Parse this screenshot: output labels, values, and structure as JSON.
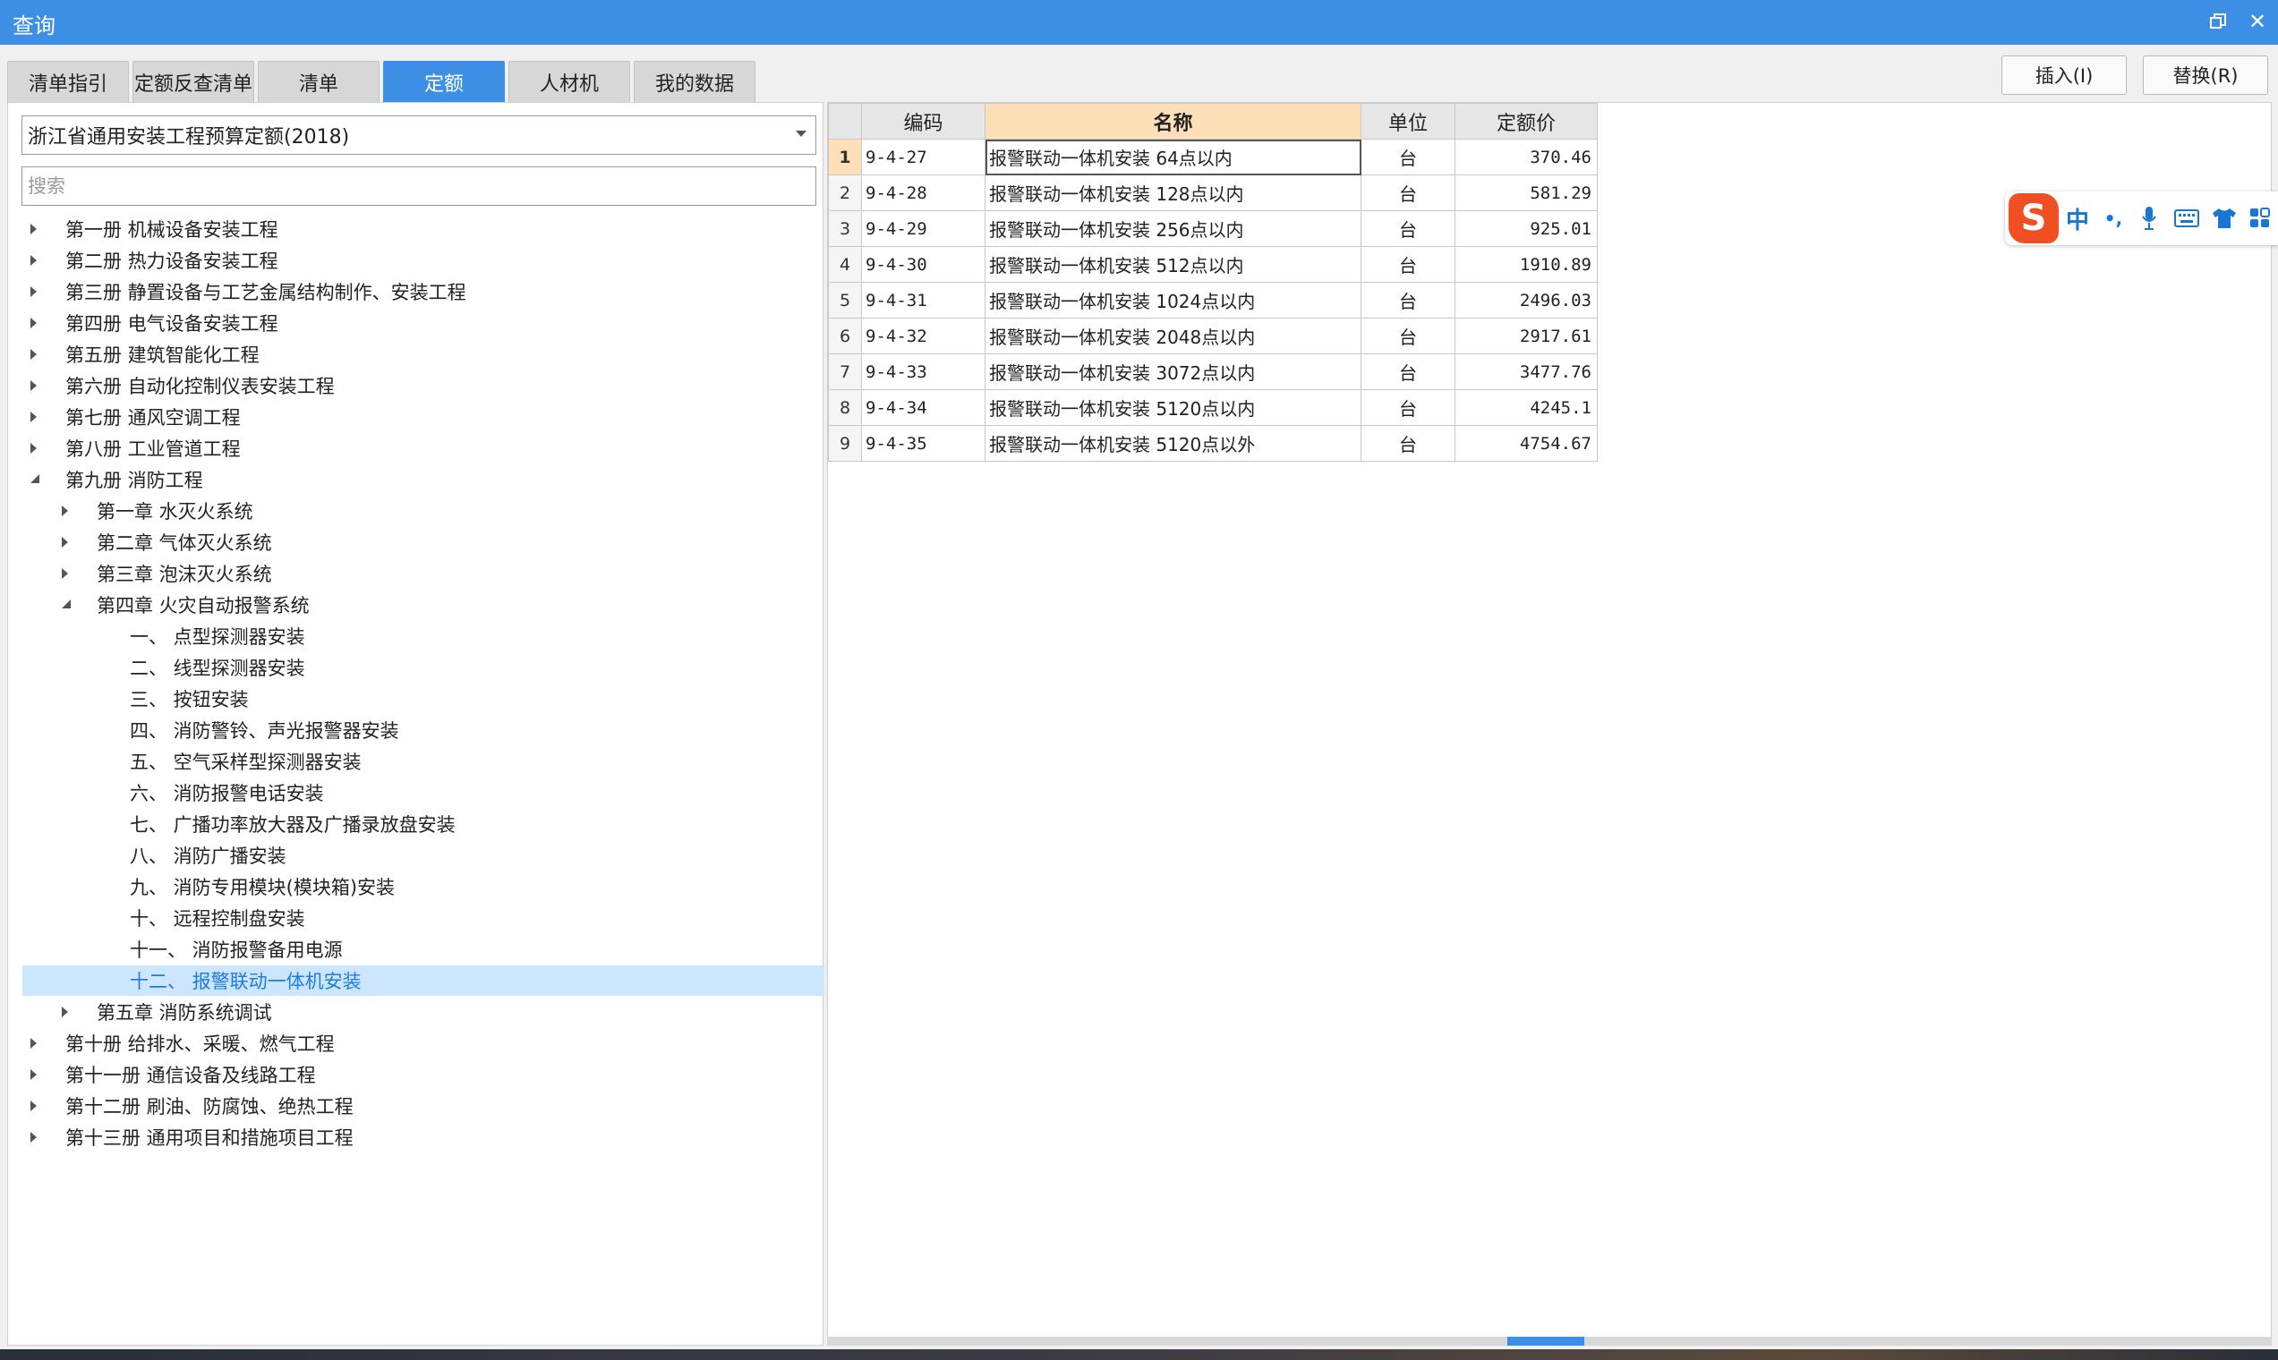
{
  "window": {
    "title": "查询"
  },
  "tabs": [
    {
      "label": "清单指引"
    },
    {
      "label": "定额反查清单"
    },
    {
      "label": "清单"
    },
    {
      "label": "定额"
    },
    {
      "label": "人材机"
    },
    {
      "label": "我的数据"
    }
  ],
  "active_tab": "定额",
  "actions": {
    "insert": "插入(I)",
    "replace": "替换(R)"
  },
  "left": {
    "library": "浙江省通用安装工程预算定额(2018)",
    "search_placeholder": "搜索",
    "tree": [
      {
        "label": "第一册 机械设备安装工程",
        "level": 0,
        "state": "collapsed"
      },
      {
        "label": "第二册 热力设备安装工程",
        "level": 0,
        "state": "collapsed"
      },
      {
        "label": "第三册 静置设备与工艺金属结构制作、安装工程",
        "level": 0,
        "state": "collapsed"
      },
      {
        "label": "第四册 电气设备安装工程",
        "level": 0,
        "state": "collapsed"
      },
      {
        "label": "第五册 建筑智能化工程",
        "level": 0,
        "state": "collapsed"
      },
      {
        "label": "第六册 自动化控制仪表安装工程",
        "level": 0,
        "state": "collapsed"
      },
      {
        "label": "第七册 通风空调工程",
        "level": 0,
        "state": "collapsed"
      },
      {
        "label": "第八册 工业管道工程",
        "level": 0,
        "state": "collapsed"
      },
      {
        "label": "第九册 消防工程",
        "level": 0,
        "state": "expanded"
      },
      {
        "label": "第一章 水灭火系统",
        "level": 1,
        "state": "collapsed"
      },
      {
        "label": "第二章 气体灭火系统",
        "level": 1,
        "state": "collapsed"
      },
      {
        "label": "第三章 泡沫灭火系统",
        "level": 1,
        "state": "collapsed"
      },
      {
        "label": "第四章 火灾自动报警系统",
        "level": 1,
        "state": "expanded"
      },
      {
        "label": "一、 点型探测器安装",
        "level": 2,
        "state": "leaf"
      },
      {
        "label": "二、 线型探测器安装",
        "level": 2,
        "state": "leaf"
      },
      {
        "label": "三、 按钮安装",
        "level": 2,
        "state": "leaf"
      },
      {
        "label": "四、 消防警铃、声光报警器安装",
        "level": 2,
        "state": "leaf"
      },
      {
        "label": "五、 空气采样型探测器安装",
        "level": 2,
        "state": "leaf"
      },
      {
        "label": "六、 消防报警电话安装",
        "level": 2,
        "state": "leaf"
      },
      {
        "label": "七、 广播功率放大器及广播录放盘安装",
        "level": 2,
        "state": "leaf"
      },
      {
        "label": "八、 消防广播安装",
        "level": 2,
        "state": "leaf"
      },
      {
        "label": "九、 消防专用模块(模块箱)安装",
        "level": 2,
        "state": "leaf"
      },
      {
        "label": "十、 远程控制盘安装",
        "level": 2,
        "state": "leaf"
      },
      {
        "label": "十一、 消防报警备用电源",
        "level": 2,
        "state": "leaf"
      },
      {
        "label": "十二、 报警联动一体机安装",
        "level": 2,
        "state": "leaf",
        "selected": true
      },
      {
        "label": "第五章 消防系统调试",
        "level": 1,
        "state": "collapsed"
      },
      {
        "label": "第十册 给排水、采暖、燃气工程",
        "level": 0,
        "state": "collapsed"
      },
      {
        "label": "第十一册 通信设备及线路工程",
        "level": 0,
        "state": "collapsed"
      },
      {
        "label": "第十二册 刷油、防腐蚀、绝热工程",
        "level": 0,
        "state": "collapsed"
      },
      {
        "label": "第十三册 通用项目和措施项目工程",
        "level": 0,
        "state": "collapsed"
      }
    ]
  },
  "grid": {
    "columns": [
      "编码",
      "名称",
      "单位",
      "定额价"
    ],
    "rows": [
      {
        "n": "1",
        "code": "9-4-27",
        "name": "报警联动一体机安装 64点以内",
        "unit": "台",
        "price": "370.46"
      },
      {
        "n": "2",
        "code": "9-4-28",
        "name": "报警联动一体机安装 128点以内",
        "unit": "台",
        "price": "581.29"
      },
      {
        "n": "3",
        "code": "9-4-29",
        "name": "报警联动一体机安装 256点以内",
        "unit": "台",
        "price": "925.01"
      },
      {
        "n": "4",
        "code": "9-4-30",
        "name": "报警联动一体机安装 512点以内",
        "unit": "台",
        "price": "1910.89"
      },
      {
        "n": "5",
        "code": "9-4-31",
        "name": "报警联动一体机安装 1024点以内",
        "unit": "台",
        "price": "2496.03"
      },
      {
        "n": "6",
        "code": "9-4-32",
        "name": "报警联动一体机安装 2048点以内",
        "unit": "台",
        "price": "2917.61"
      },
      {
        "n": "7",
        "code": "9-4-33",
        "name": "报警联动一体机安装 3072点以内",
        "unit": "台",
        "price": "3477.76"
      },
      {
        "n": "8",
        "code": "9-4-34",
        "name": "报警联动一体机安装 5120点以内",
        "unit": "台",
        "price": "4245.1"
      },
      {
        "n": "9",
        "code": "9-4-35",
        "name": "报警联动一体机安装 5120点以外",
        "unit": "台",
        "price": "4754.67"
      }
    ]
  },
  "ime": {
    "logo": "S",
    "mode": "中",
    "punct": "•,",
    "mic": "mic-icon",
    "keyboard": "keyboard-icon",
    "skin": "shirt-icon",
    "toolbox": "grid-icon"
  },
  "colors": {
    "accent": "#3d8fe6",
    "selected_row": "#cce6ff",
    "sorted_header": "#fde0b8",
    "ime_logo": "#f04f23"
  }
}
